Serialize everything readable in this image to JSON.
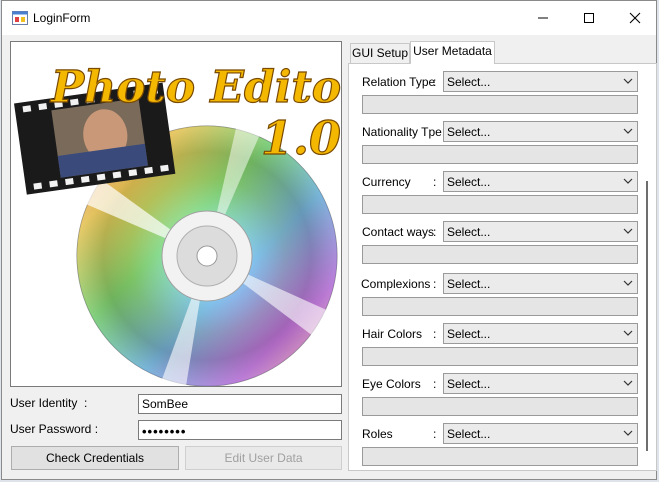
{
  "window": {
    "title": "LoginForm"
  },
  "login": {
    "identity_label": "User Identity",
    "identity_colon": ":",
    "identity_value": "SomBee",
    "password_label": "User Password :",
    "password_masked": "••••••••",
    "check_button": "Check Credentials",
    "edit_button": "Edit User Data"
  },
  "picture": {
    "title_line1": "Photo Editor",
    "title_line2": "1.0"
  },
  "tabs": [
    {
      "label": "GUI Setup"
    },
    {
      "label": "User Metadata"
    }
  ],
  "metadata": {
    "fields": [
      {
        "label": "Relation Type",
        "colon": ":",
        "value": "Select..."
      },
      {
        "label": "Nationality Tpe:",
        "colon": "",
        "value": "Select..."
      },
      {
        "label": "Currency",
        "colon": ":",
        "value": "Select..."
      },
      {
        "label": "Contact ways",
        "colon": ":",
        "value": "Select..."
      },
      {
        "label": "Complexions",
        "colon": ":",
        "value": "Select..."
      },
      {
        "label": "Hair Colors",
        "colon": ":",
        "value": "Select..."
      },
      {
        "label": "Eye Colors",
        "colon": ":",
        "value": "Select..."
      },
      {
        "label": "Roles",
        "colon": ":",
        "value": "Select..."
      }
    ]
  },
  "colors": {
    "logo_gold": "#f5b800",
    "logo_outline": "#7a4a00"
  }
}
